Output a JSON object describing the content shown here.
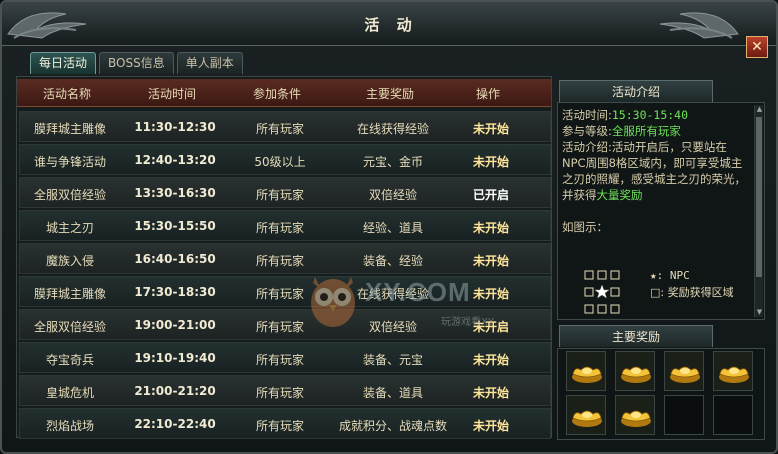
{
  "window": {
    "title": "活 动",
    "close_label": "✕"
  },
  "tabs": [
    {
      "label": "每日活动",
      "active": true
    },
    {
      "label": "BOSS信息",
      "active": false
    },
    {
      "label": "单人副本",
      "active": false
    }
  ],
  "table": {
    "headers": [
      "活动名称",
      "活动时间",
      "参加条件",
      "主要奖励",
      "操作"
    ],
    "rows": [
      {
        "name": "膜拜城主雕像",
        "time": "11:30-12:30",
        "condition": "所有玩家",
        "reward": "在线获得经验",
        "status": "未开始"
      },
      {
        "name": "谁与争锋活动",
        "time": "12:40-13:20",
        "condition": "50级以上",
        "reward": "元宝、金币",
        "status": "未开始"
      },
      {
        "name": "全服双倍经验",
        "time": "13:30-16:30",
        "condition": "所有玩家",
        "reward": "双倍经验",
        "status": "已开启"
      },
      {
        "name": "城主之刃",
        "time": "15:30-15:50",
        "condition": "所有玩家",
        "reward": "经验、道具",
        "status": "未开始"
      },
      {
        "name": "魔族入侵",
        "time": "16:40-16:50",
        "condition": "所有玩家",
        "reward": "装备、经验",
        "status": "未开始"
      },
      {
        "name": "膜拜城主雕像",
        "time": "17:30-18:30",
        "condition": "所有玩家",
        "reward": "在线获得经验",
        "status": "未开始"
      },
      {
        "name": "全服双倍经验",
        "time": "19:00-21:00",
        "condition": "所有玩家",
        "reward": "双倍经验",
        "status": "未开启"
      },
      {
        "name": "夺宝奇兵",
        "time": "19:10-19:40",
        "condition": "所有玩家",
        "reward": "装备、元宝",
        "status": "未开始"
      },
      {
        "name": "皇城危机",
        "time": "21:00-21:20",
        "condition": "所有玩家",
        "reward": "装备、道具",
        "status": "未开始"
      },
      {
        "name": "烈焰战场",
        "time": "22:10-22:40",
        "condition": "所有玩家",
        "reward": "成就积分、战魂点数",
        "status": "未开始"
      }
    ]
  },
  "watermark": {
    "text": "XY.COM",
    "sub": "玩游戏看XY"
  },
  "intro": {
    "heading": "活动介绍",
    "time_label": "活动时间:",
    "time_value": "15:30-15:40",
    "level_label": "参与等级:",
    "level_value": "全服所有玩家",
    "desc_label": "活动介绍:",
    "desc_text": "活动开启后，只要站在NPC周围8格区域内，即可享受城主之刃的照耀，感受城主之刃的荣光，并获得",
    "desc_highlight": "大量奖励",
    "figure_label": "如图示：",
    "legend_npc": "★: NPC",
    "legend_zone": "□: 奖励获得区域"
  },
  "rewards": {
    "heading": "主要奖励",
    "slots": [
      "gold-ingot",
      "gold-ingot",
      "gold-ingot",
      "gold-ingot",
      "gold-ingot",
      "gold-ingot",
      "empty",
      "empty"
    ]
  }
}
